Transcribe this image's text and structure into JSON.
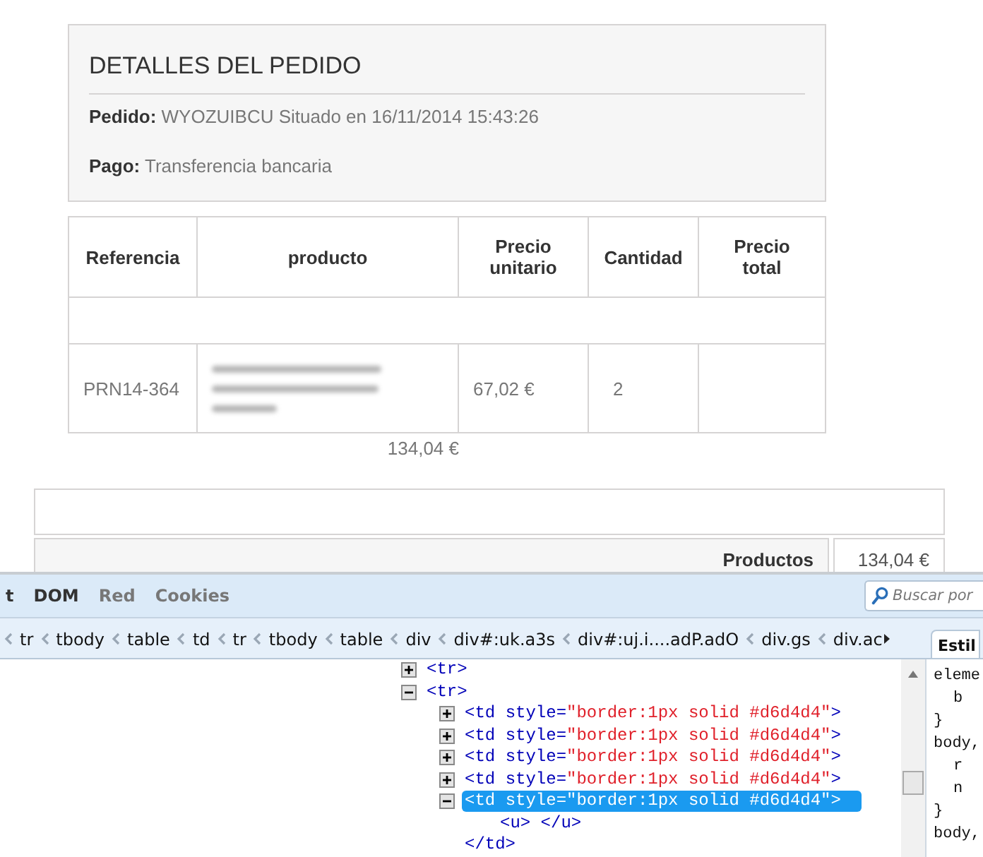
{
  "order_details": {
    "title": "DETALLES DEL PEDIDO",
    "order_label": "Pedido:",
    "order_value": "WYOZUIBCU Situado en 16/11/2014 15:43:26",
    "payment_label": "Pago:",
    "payment_value": "Transferencia bancaria"
  },
  "products_table": {
    "columns": [
      "Referencia",
      "producto",
      "Precio unitario",
      "Cantidad",
      "Precio total"
    ],
    "rows": [
      {
        "reference": "PRN14-364",
        "unit_price": "67,02 €",
        "quantity": "2"
      }
    ]
  },
  "total": "134,04 €",
  "summary": {
    "label": "Productos",
    "value": "134,04 €"
  },
  "devtools": {
    "tabs": [
      {
        "label": "t",
        "disabled": false
      },
      {
        "label": "DOM",
        "disabled": false
      },
      {
        "label": "Red",
        "disabled": true
      },
      {
        "label": "Cookies",
        "disabled": true
      }
    ],
    "search_placeholder": "Buscar por",
    "breadcrumbs": [
      "tr",
      "tbody",
      "table",
      "td",
      "tr",
      "tbody",
      "table",
      "div",
      "div#:uk.a3s",
      "div#:uj.i....adP.adO",
      "div.gs",
      "div.ac"
    ],
    "side_tab": "Estil",
    "tree": [
      {
        "parts": [
          {
            "kind": "tag",
            "text": "<tr>"
          }
        ],
        "expanded": false,
        "selected": false
      },
      {
        "parts": [
          {
            "kind": "tag",
            "text": "<tr>"
          }
        ],
        "expanded": true,
        "selected": false,
        "children": [
          {
            "parts": [
              {
                "kind": "tag",
                "text": "<td "
              },
              {
                "kind": "attr",
                "text": "style="
              },
              {
                "kind": "value",
                "text": "\"border:1px solid #d6d4d4\""
              },
              {
                "kind": "tag",
                "text": ">"
              }
            ],
            "expanded": false,
            "selected": false
          },
          {
            "parts": [
              {
                "kind": "tag",
                "text": "<td "
              },
              {
                "kind": "attr",
                "text": "style="
              },
              {
                "kind": "value",
                "text": "\"border:1px solid #d6d4d4\""
              },
              {
                "kind": "tag",
                "text": ">"
              }
            ],
            "expanded": false,
            "selected": false
          },
          {
            "parts": [
              {
                "kind": "tag",
                "text": "<td "
              },
              {
                "kind": "attr",
                "text": "style="
              },
              {
                "kind": "value",
                "text": "\"border:1px solid #d6d4d4\""
              },
              {
                "kind": "tag",
                "text": ">"
              }
            ],
            "expanded": false,
            "selected": false
          },
          {
            "parts": [
              {
                "kind": "tag",
                "text": "<td "
              },
              {
                "kind": "attr",
                "text": "style="
              },
              {
                "kind": "value",
                "text": "\"border:1px solid #d6d4d4\""
              },
              {
                "kind": "tag",
                "text": ">"
              }
            ],
            "expanded": false,
            "selected": false
          },
          {
            "parts": [
              {
                "kind": "tag",
                "text": "<td "
              },
              {
                "kind": "attr",
                "text": "style="
              },
              {
                "kind": "value",
                "text": "\"border:1px solid #d6d4d4\""
              },
              {
                "kind": "tag",
                "text": ">"
              }
            ],
            "expanded": true,
            "selected": true,
            "close": "</td>",
            "children": [
              {
                "parts": [
                  {
                    "kind": "tag",
                    "text": "<u> </u>"
                  }
                ],
                "selected": false
              }
            ]
          }
        ]
      }
    ],
    "css_lines": [
      {
        "text": "eleme",
        "indent": false
      },
      {
        "text": "b",
        "indent": true
      },
      {
        "text": "}",
        "indent": false
      },
      {
        "text": "body,",
        "indent": false
      },
      {
        "text": "r",
        "indent": true
      },
      {
        "text": "n",
        "indent": true
      },
      {
        "text": "}",
        "indent": false
      },
      {
        "text": "body,",
        "indent": false
      }
    ]
  }
}
